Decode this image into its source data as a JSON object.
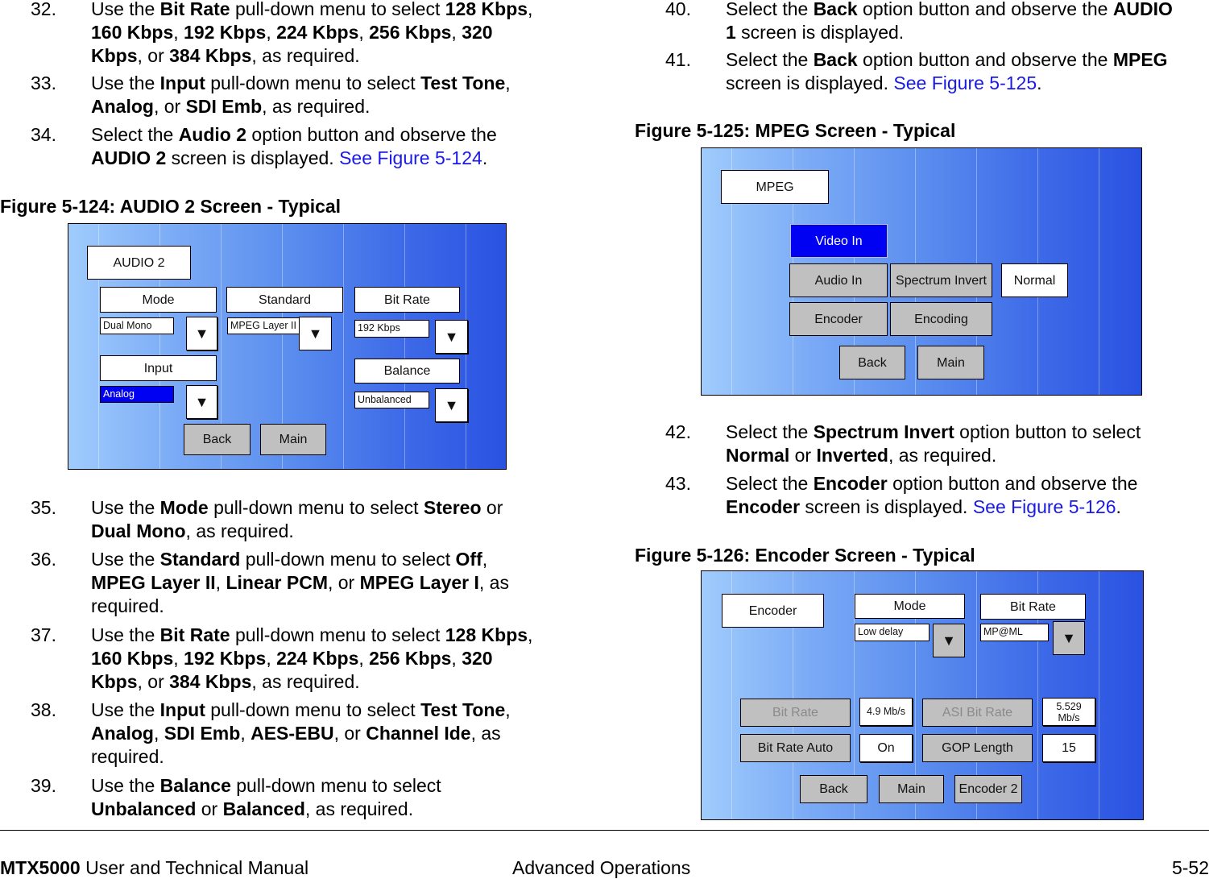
{
  "left_column": {
    "steps_top": [
      {
        "num": "32.",
        "lines": [
          "Use the <b>Bit Rate</b> pull-down menu to select <b>128 Kbps</b>,",
          "<b>160 Kbps</b>, <b>192 Kbps</b>, <b>224 Kbps</b>, <b>256 Kbps</b>, <b>320</b>",
          "<b>Kbps</b>, or <b>384 Kbps</b>, as required."
        ]
      },
      {
        "num": "33.",
        "lines": [
          "Use the <b>Input</b> pull-down menu to select <b>Test Tone</b>,",
          "<b>Analog</b>, or <b>SDI Emb</b>, as required."
        ]
      },
      {
        "num": "34.",
        "lines": [
          "Select the <b>Audio 2</b> option button and observe the",
          "<b>AUDIO 2</b> screen is displayed.  <span class=\"link\">See Figure 5-124</span>."
        ]
      }
    ],
    "figure_124": {
      "caption": "Figure 5-124:   AUDIO 2 Screen - Typical",
      "screen_title": "AUDIO 2",
      "mode_label": "Mode",
      "mode_value": "Dual Mono",
      "standard_label": "Standard",
      "standard_value": "MPEG Layer II",
      "bitrate_label": "Bit Rate",
      "bitrate_value": "192 Kbps",
      "input_label": "Input",
      "input_value": "Analog",
      "balance_label": "Balance",
      "balance_value": "Unbalanced",
      "dropdown_glyph": "▼",
      "back_label": "Back",
      "main_label": "Main"
    },
    "steps_bottom": [
      {
        "num": "35.",
        "lines": [
          "Use the <b>Mode</b> pull-down menu to select <b>Stereo</b> or",
          "<b>Dual Mono</b>, as required."
        ]
      },
      {
        "num": "36.",
        "lines": [
          "Use the <b>Standard</b> pull-down menu to select <b>Off</b>,",
          "<b>MPEG Layer II</b>, <b>Linear PCM</b>, or <b>MPEG Layer I</b>, as",
          "required."
        ]
      },
      {
        "num": "37.",
        "lines": [
          "Use the <b>Bit Rate</b> pull-down menu to select <b>128 Kbps</b>,",
          "<b>160 Kbps</b>, <b>192 Kbps</b>, <b>224 Kbps</b>, <b>256 Kbps</b>, <b>320</b>",
          "<b>Kbps</b>, or <b>384 Kbps</b>, as required."
        ]
      },
      {
        "num": "38.",
        "lines": [
          "Use the <b>Input</b> pull-down menu to select <b>Test Tone</b>,",
          "<b>Analog</b>, <b>SDI Emb</b>, <b>AES-EBU</b>, or <b>Channel Ide</b>, as",
          "required."
        ]
      },
      {
        "num": "39.",
        "lines": [
          "Use the <b>Balance</b> pull-down menu to select",
          "<b>Unbalanced</b> or <b>Balanced</b>, as required."
        ]
      }
    ]
  },
  "right_column": {
    "steps_top": [
      {
        "num": "40.",
        "lines": [
          "Select the <b>Back</b> option button and observe the <b>AUDIO</b>",
          "<b>1</b> screen is displayed."
        ]
      },
      {
        "num": "41.",
        "lines": [
          "Select the <b>Back</b> option button and observe the <b>MPEG</b>",
          "screen is displayed.  <span class=\"link\">See Figure 5-125</span>."
        ]
      }
    ],
    "figure_125": {
      "caption": "Figure 5-125:   MPEG Screen - Typical",
      "screen_title": "MPEG",
      "video_in_label": "Video In",
      "audio_in_label": "Audio In",
      "spectrum_invert_label": "Spectrum Invert",
      "spectrum_value": "Normal",
      "encoder_label": "Encoder",
      "encoding_label": "Encoding",
      "back_label": "Back",
      "main_label": "Main"
    },
    "steps_mid": [
      {
        "num": "42.",
        "lines": [
          "Select the <b>Spectrum Invert</b> option button to select",
          "<b>Normal</b> or <b>Inverted</b>, as required."
        ]
      },
      {
        "num": "43.",
        "lines": [
          "Select the <b>Encoder</b> option button and observe the",
          "<b>Encoder</b> screen is displayed.  <span class=\"link\">See Figure 5-126</span>."
        ]
      }
    ],
    "figure_126": {
      "caption": "Figure 5-126:   Encoder Screen - Typical",
      "screen_title": "Encoder",
      "mode_label": "Mode",
      "mode_value": "Low delay",
      "bitrate_label": "Bit Rate",
      "bitrate_value": "MP@ML",
      "dropdown_glyph": "▼",
      "bitrate_btn_label": "Bit Rate",
      "bitrate_readout": "4.9 Mb/s",
      "asi_bitrate_label": "ASI Bit Rate",
      "asi_bitrate_readout_line1": "5.529",
      "asi_bitrate_readout_line2": "Mb/s",
      "bitrate_auto_label": "Bit Rate Auto",
      "bitrate_auto_value": "On",
      "gop_length_label": "GOP Length",
      "gop_length_value": "15",
      "back_label": "Back",
      "main_label": "Main",
      "encoder2_label": "Encoder 2"
    }
  },
  "footer": {
    "product": "MTX5000",
    "manual": " User and Technical Manual",
    "section": "Advanced Operations",
    "page": "5-52"
  },
  "colors": {
    "link": "#1a1ae6",
    "selected_blue": "#0000f2",
    "button_gray": "#c0c0c0"
  }
}
